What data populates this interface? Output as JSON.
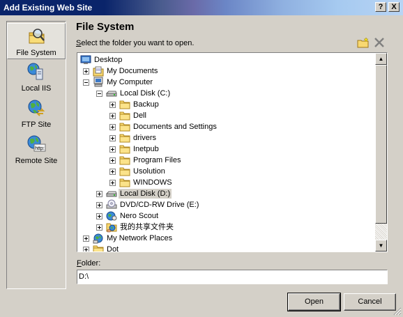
{
  "window": {
    "title": "Add Existing Web Site",
    "help_glyph": "?",
    "close_glyph": "X"
  },
  "places": [
    {
      "label": "File System",
      "icon": "file-system-icon",
      "selected": true
    },
    {
      "label": "Local IIS",
      "icon": "local-iis-icon",
      "selected": false
    },
    {
      "label": "FTP Site",
      "icon": "ftp-site-icon",
      "selected": false
    },
    {
      "label": "Remote Site",
      "icon": "remote-site-icon",
      "selected": false
    }
  ],
  "main": {
    "heading": "File System",
    "subtitle_accel": "S",
    "subtitle_rest": "elect the folder you want to open."
  },
  "tree": {
    "items": [
      {
        "label": "Desktop",
        "icon": "desktop-icon",
        "expander": "none"
      },
      {
        "label": "My Documents",
        "icon": "my-documents-icon",
        "expander": "plus"
      },
      {
        "label": "My Computer",
        "icon": "my-computer-icon",
        "expander": "minus"
      },
      {
        "label": "Local Disk (C:)",
        "icon": "hard-disk-icon",
        "expander": "minus"
      },
      {
        "label": "Backup",
        "icon": "folder-icon",
        "expander": "plus"
      },
      {
        "label": "Dell",
        "icon": "folder-icon",
        "expander": "plus"
      },
      {
        "label": "Documents and Settings",
        "icon": "folder-icon",
        "expander": "plus"
      },
      {
        "label": "drivers",
        "icon": "folder-icon",
        "expander": "plus"
      },
      {
        "label": "Inetpub",
        "icon": "folder-icon",
        "expander": "plus"
      },
      {
        "label": "Program Files",
        "icon": "folder-icon",
        "expander": "plus"
      },
      {
        "label": "Usolution",
        "icon": "folder-icon",
        "expander": "plus"
      },
      {
        "label": "WINDOWS",
        "icon": "folder-icon",
        "expander": "plus"
      },
      {
        "label": "Local Disk (D:)",
        "icon": "hard-disk-icon",
        "expander": "plus",
        "selected": true
      },
      {
        "label": "DVD/CD-RW Drive (E:)",
        "icon": "dvd-drive-icon",
        "expander": "plus"
      },
      {
        "label": "Nero Scout",
        "icon": "nero-scout-icon",
        "expander": "plus"
      },
      {
        "label": "我的共享文件夹",
        "icon": "shared-folder-icon",
        "expander": "plus"
      },
      {
        "label": "My Network Places",
        "icon": "network-places-icon",
        "expander": "plus"
      },
      {
        "label": "Dot",
        "icon": "folder-icon",
        "expander": "plus"
      }
    ]
  },
  "folder": {
    "label_accel": "F",
    "label_rest": "older:",
    "value": "D:\\"
  },
  "buttons": {
    "open": "Open",
    "cancel": "Cancel"
  },
  "colors": {
    "title_bar": "#0a246a",
    "dialog_face": "#d4d0c8",
    "folder_yellow": "#f8d870"
  }
}
